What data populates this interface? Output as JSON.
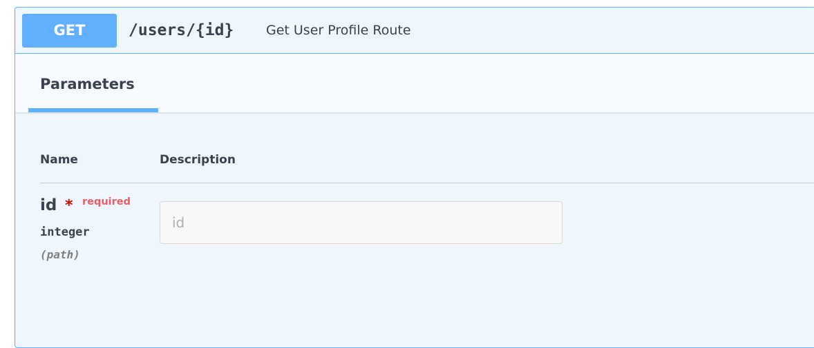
{
  "operation": {
    "method": "GET",
    "path": "/users/{id}",
    "summary": "Get User Profile Route"
  },
  "section": {
    "tab_label": "Parameters"
  },
  "table": {
    "headers": [
      "Name",
      "Description"
    ]
  },
  "parameters": [
    {
      "name": "id",
      "required_marker": "*",
      "required_label": "required",
      "type": "integer",
      "location": "(path)",
      "input_placeholder": "id",
      "input_value": ""
    }
  ],
  "colors": {
    "get_method": "#61affe",
    "block_background": "#eff6fd",
    "text": "#3b4151",
    "required_star": "#e40000",
    "required_label": "#f05c63"
  }
}
